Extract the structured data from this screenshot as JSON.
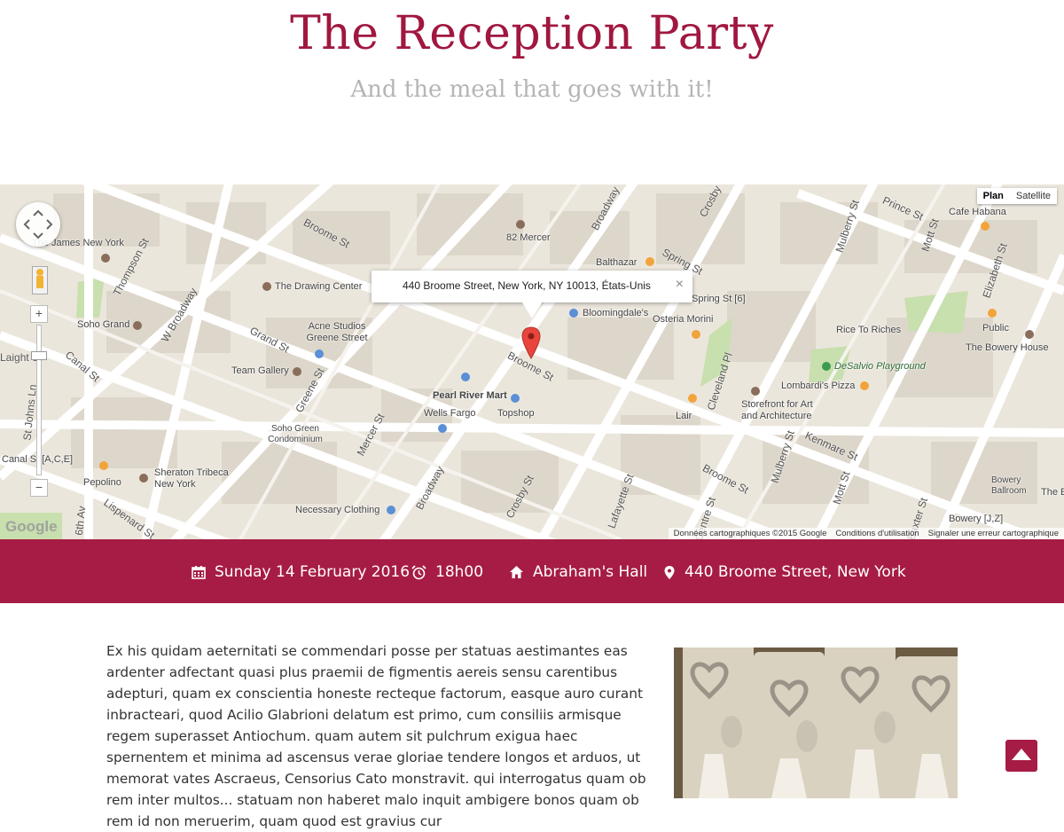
{
  "header": {
    "title": "The Reception Party",
    "subtitle": "And the meal that goes with it!"
  },
  "map": {
    "map_type": {
      "plan": "Plan",
      "satellite": "Satellite",
      "selected": "Plan"
    },
    "info_window": {
      "address": "440 Broome Street, New York, NY 10013, États-Unis",
      "close": "×"
    },
    "streets": [
      "Broome St",
      "Broome St",
      "Broome St",
      "Broome St",
      "Grand St",
      "W Broadway",
      "Canal St",
      "Thompson St",
      "Greene St",
      "Mercer St",
      "Broadway",
      "Broadway",
      "Crosby St",
      "Lafayette St",
      "Cleveland Pl",
      "Mulberry St",
      "Mulberry St",
      "Mott St",
      "Mott St",
      "Elizabeth St",
      "Kenmare St",
      "Prince St",
      "Spring St",
      "Lispenard St",
      "St Johns Ln",
      "6th Av",
      "Crosby",
      "Laight St",
      "Centre St",
      "Baxter St"
    ],
    "places": [
      "82 Mercer",
      "Balthazar",
      "Spring St [6]",
      "Cafe Habana",
      "Bloomingdale's",
      "Osteria Morini",
      "The Drawing Center",
      "Acne Studios Greene Street",
      "Team Gallery",
      "Pearl River Mart",
      "Wells Fargo",
      "Topshop",
      "Soho Grand",
      "Soho Green Condominium",
      "Sheraton Tribeca New York",
      "Pepolino",
      "Necessary Clothing",
      "Canal St [A,C,E]",
      "Rice To Riches",
      "Public",
      "The Bowery House",
      "DeSalvio Playground",
      "Lombardi's Pizza",
      "Storefront for Art and Architecture",
      "Lair",
      "Bowery Ballroom",
      "Bowery [J,Z]",
      "The James New York",
      "Thompson St",
      "The E"
    ],
    "zoom": {
      "in": "+",
      "out": "−"
    },
    "logo": "Google",
    "credits": {
      "data": "Données cartographiques ©2015 Google",
      "terms": "Conditions d'utilisation",
      "report": "Signaler une erreur cartographique"
    },
    "colors": {
      "land": "#ebe6dc",
      "blocks": "#ddd6ca",
      "roads": "#ffffff",
      "park": "#c8dfae",
      "marker": "#e8453c"
    }
  },
  "event": {
    "date": "Sunday 14 February 2016",
    "time": "18h00",
    "venue": "Abraham's Hall",
    "address": "440 Broome Street, New York",
    "icons": [
      "calendar-icon",
      "alarm-clock-icon",
      "home-icon",
      "map-pin-icon"
    ],
    "bar_color": "#a61c44"
  },
  "content": {
    "paragraph": "Ex his quidam aeternitati se commendari posse per statuas aestimantes eas ardenter adfectant quasi plus praemii de figmentis aereis sensu carentibus adepturi, quam ex conscientia honeste recteque factorum, easque auro curant inbracteari, quod Acilio Glabrioni delatum est primo, cum consiliis armisque regem superasset Antiochum. quam autem sit pulchrum exigua haec spernentem et minima ad ascensus verae gloriae tendere longos et arduos, ut memorat vates Ascraeus, Censorius Cato monstravit. qui interrogatus quam ob rem inter multos... statuam non haberet malo inquit ambigere bonos quam ob rem id non meruerim, quam quod est gravius cur"
  },
  "back_to_top": {
    "icon": "arrow-up-icon"
  }
}
